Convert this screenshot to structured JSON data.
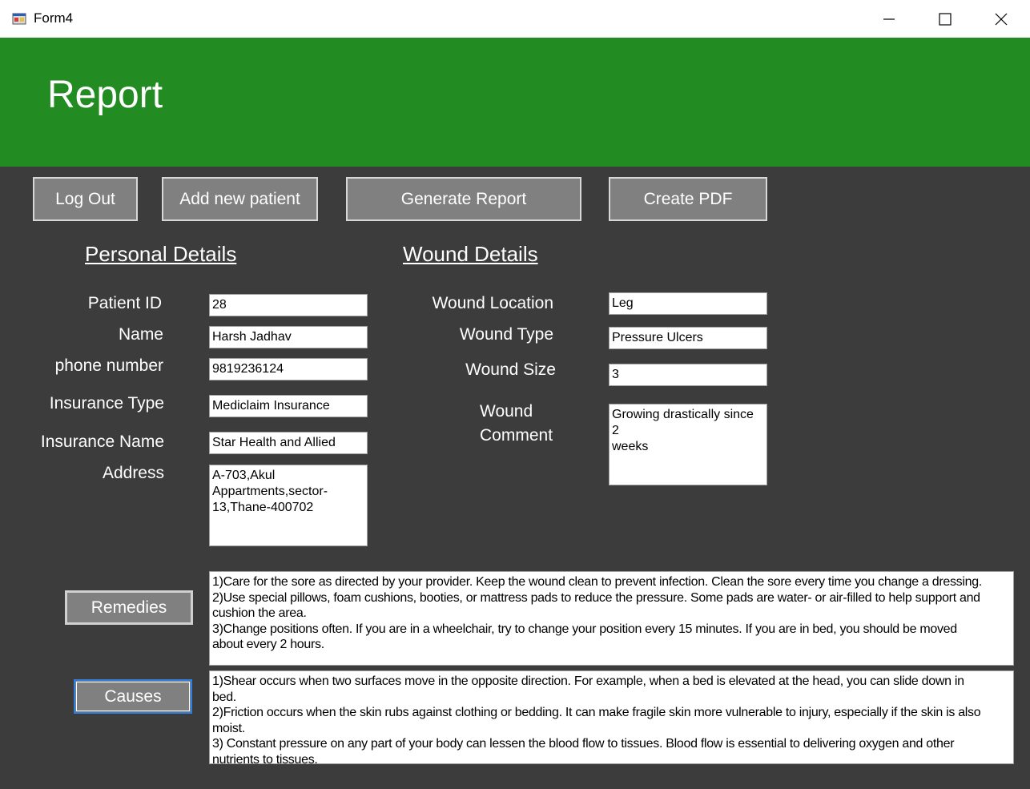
{
  "window": {
    "title": "Form4"
  },
  "banner": {
    "title": "Report"
  },
  "toolbar": {
    "logout_label": "Log Out",
    "add_patient_label": "Add new patient",
    "generate_report_label": "Generate Report",
    "create_pdf_label": "Create PDF"
  },
  "personal": {
    "heading": "Personal Details",
    "patient_id_label": "Patient ID",
    "patient_id_value": "28",
    "name_label": "Name",
    "name_value": "Harsh Jadhav",
    "phone_label": "phone number",
    "phone_value": "9819236124",
    "insurance_type_label": "Insurance Type",
    "insurance_type_value": "Mediclaim Insurance",
    "insurance_name_label": "Insurance Name",
    "insurance_name_value": "Star Health and Allied",
    "address_label": "Address",
    "address_value": "A-703,Akul\nAppartments,sector-\n13,Thane-400702"
  },
  "wound": {
    "heading": "Wound Details",
    "location_label": "Wound Location",
    "location_value": "Leg",
    "type_label": "Wound Type",
    "type_value": "Pressure Ulcers",
    "size_label": "Wound Size",
    "size_value": "3",
    "comment_label_line1": "Wound",
    "comment_label_line2": "Comment",
    "comment_value": "Growing drastically since 2\nweeks"
  },
  "remedies": {
    "button_label": "Remedies",
    "text": "1)Care for the sore as directed by your provider. Keep the wound clean to prevent infection. Clean the sore every time you change a dressing.\n2)Use special pillows, foam cushions, booties, or mattress pads to reduce the pressure. Some pads are water- or air-filled to help support and\ncushion the area.\n3)Change positions often. If you are in a wheelchair, try to change your position every 15 minutes. If you are in bed, you should be moved\nabout every 2 hours."
  },
  "causes": {
    "button_label": "Causes",
    "text": "1)Shear occurs when two surfaces move in the opposite direction. For example, when a bed is elevated at the head, you can slide down in\nbed.\n2)Friction occurs when the skin rubs against clothing or bedding. It can make fragile skin more vulnerable to injury, especially if the skin is also\nmoist.\n3) Constant pressure on any part of your body can lessen the blood flow to tissues. Blood flow is essential to delivering oxygen and other\nnutrients to tissues."
  },
  "colors": {
    "banner": "#228b22",
    "background": "#3c3c3c",
    "button": "#808080"
  }
}
